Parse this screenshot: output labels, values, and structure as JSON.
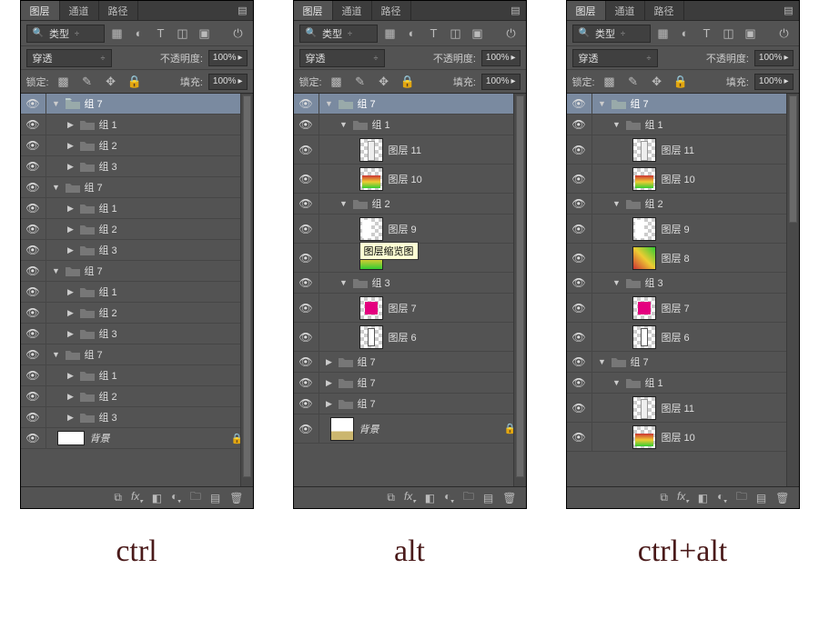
{
  "captions": {
    "ctrl": "ctrl",
    "alt": "alt",
    "ctrlalt": "ctrl+alt"
  },
  "tabs": {
    "layers": "图层",
    "channels": "通道",
    "paths": "路径"
  },
  "filter": {
    "type": "类型"
  },
  "blend": {
    "mode": "穿透",
    "opacity_label": "不透明度:",
    "opacity_value": "100%"
  },
  "lock": {
    "label": "锁定:",
    "fill_label": "填充:",
    "fill_value": "100%"
  },
  "names": {
    "group7": "组 7",
    "group1": "组 1",
    "group2": "组 2",
    "group3": "组 3",
    "layer11": "图层 11",
    "layer10": "图层 10",
    "layer9": "图层 9",
    "layer8": "图层 8",
    "layer7": "图层 7",
    "layer6": "图层 6",
    "background": "背景"
  },
  "tooltip": {
    "thumb": "图层缩览图"
  },
  "icons": {
    "search": "🔍",
    "eye": "👁",
    "link": "⧉",
    "fx": "fx.",
    "mask": "◧",
    "adjust": "◐.",
    "folder": "🗀",
    "new": "▤",
    "trash": "🗑",
    "menu": "▤≡"
  }
}
